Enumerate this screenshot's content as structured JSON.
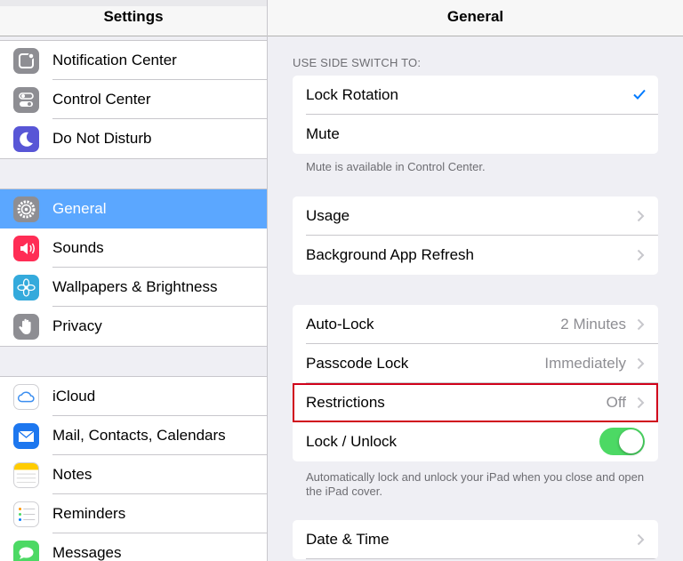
{
  "left_pane": {
    "title": "Settings",
    "groups": [
      {
        "items": [
          {
            "label": "Notification Center",
            "icon": "notification-center-icon",
            "color": "#8e8e93"
          },
          {
            "label": "Control Center",
            "icon": "control-center-icon",
            "color": "#8e8e93"
          },
          {
            "label": "Do Not Disturb",
            "icon": "moon-icon",
            "color": "#5856d6"
          }
        ]
      },
      {
        "items": [
          {
            "label": "General",
            "icon": "gear-icon",
            "color": "#8e8e93",
            "selected": true
          },
          {
            "label": "Sounds",
            "icon": "speaker-icon",
            "color": "#ff2d55"
          },
          {
            "label": "Wallpapers & Brightness",
            "icon": "flower-icon",
            "color": "#34aadc"
          },
          {
            "label": "Privacy",
            "icon": "hand-icon",
            "color": "#8e8e93"
          }
        ]
      },
      {
        "items": [
          {
            "label": "iCloud",
            "icon": "cloud-icon",
            "color": "#ffffff"
          },
          {
            "label": "Mail, Contacts, Calendars",
            "icon": "mail-icon",
            "color": "#1d77ef"
          },
          {
            "label": "Notes",
            "icon": "notes-icon",
            "color": "#ffffff"
          },
          {
            "label": "Reminders",
            "icon": "reminders-icon",
            "color": "#ffffff"
          },
          {
            "label": "Messages",
            "icon": "messages-icon",
            "color": "#4cd964"
          }
        ]
      }
    ]
  },
  "right_pane": {
    "title": "General",
    "side_switch": {
      "header": "USE SIDE SWITCH TO:",
      "options": [
        {
          "label": "Lock Rotation",
          "checked": true
        },
        {
          "label": "Mute",
          "checked": false
        }
      ],
      "footer": "Mute is available in Control Center."
    },
    "usage_group": [
      {
        "label": "Usage"
      },
      {
        "label": "Background App Refresh"
      }
    ],
    "lock_group": {
      "rows": [
        {
          "label": "Auto-Lock",
          "value": "2 Minutes"
        },
        {
          "label": "Passcode Lock",
          "value": "Immediately"
        },
        {
          "label": "Restrictions",
          "value": "Off",
          "highlighted": true
        },
        {
          "label": "Lock / Unlock",
          "toggle_on": true
        }
      ],
      "footer": "Automatically lock and unlock your iPad when you close and open the iPad cover."
    },
    "date_group": [
      {
        "label": "Date & Time"
      }
    ]
  },
  "colors": {
    "accent": "#007aff",
    "selection": "#5ba7ff",
    "toggle_on": "#4cd964",
    "highlight_box": "#d0021b"
  }
}
